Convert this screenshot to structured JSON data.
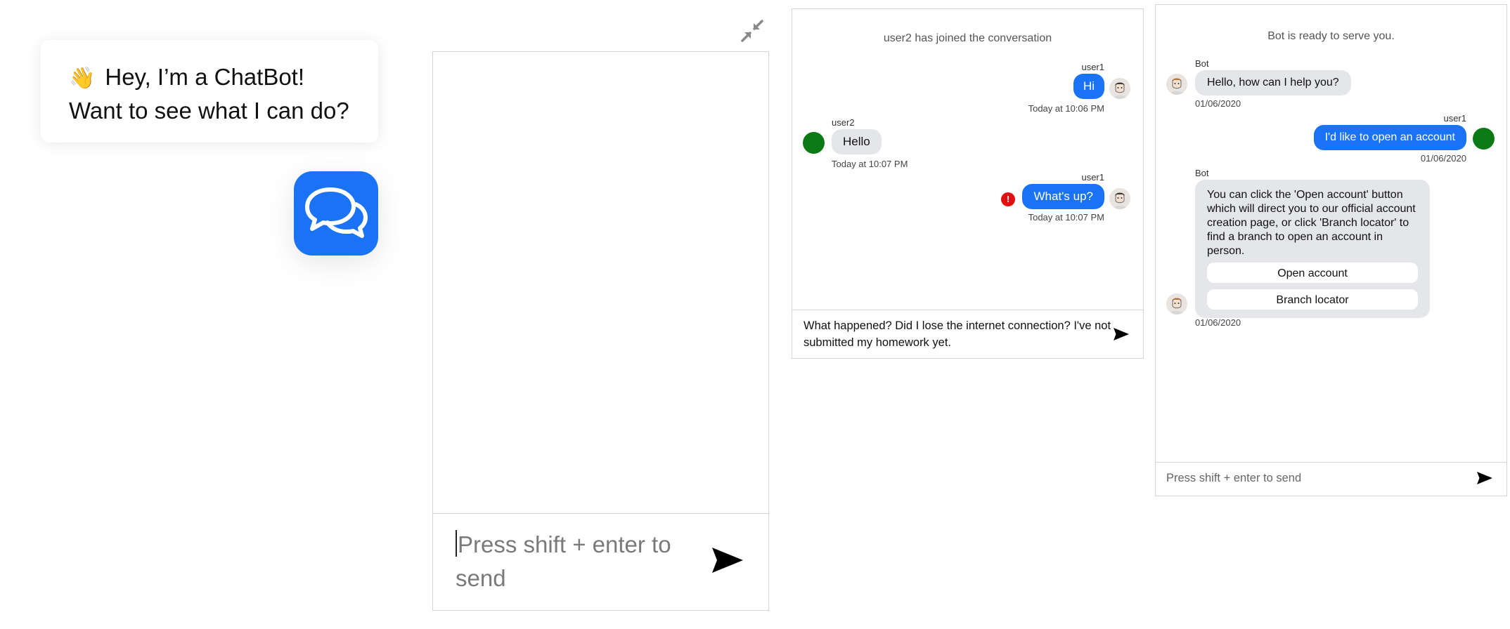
{
  "launcher": {
    "wave_emoji": "👋",
    "greeting_line1": "Hey, I’m a ChatBot!",
    "greeting_line2": "Want to see what I can do?",
    "button_color": "#1a73f5"
  },
  "panel_large": {
    "input_placeholder": "Press shift + enter to send"
  },
  "panel_conversation": {
    "system_message": "user2 has joined the conversation",
    "messages": [
      {
        "author": "user1",
        "text": "Hi",
        "time": "Today at 10:06 PM"
      },
      {
        "author": "user2",
        "text": "Hello",
        "time": "Today at 10:07 PM"
      },
      {
        "author": "user1",
        "text": "What's up?",
        "time": "Today at 10:07 PM",
        "error": "!"
      }
    ],
    "input_value": "What happened? Did I lose the internet connection? I've not submitted my homework yet."
  },
  "panel_bot": {
    "system_message": "Bot is ready to serve you.",
    "messages": [
      {
        "author": "Bot",
        "text": "Hello, how can I help you?",
        "date": "01/06/2020"
      },
      {
        "author": "user1",
        "text": "I'd like to open an account",
        "date": "01/06/2020"
      },
      {
        "author": "Bot",
        "text": "You can click the 'Open account' button which will direct you to our official account creation page, or click 'Branch locator' to find a branch to open an account in person.",
        "date": "01/06/2020",
        "quick_replies": [
          "Open account",
          "Branch locator"
        ]
      }
    ],
    "input_placeholder": "Press shift + enter to send"
  },
  "colors": {
    "accent": "#1a73f5",
    "user2_avatar": "#0b7a14",
    "error": "#e01010",
    "bubble_in": "#e4e6ea"
  }
}
